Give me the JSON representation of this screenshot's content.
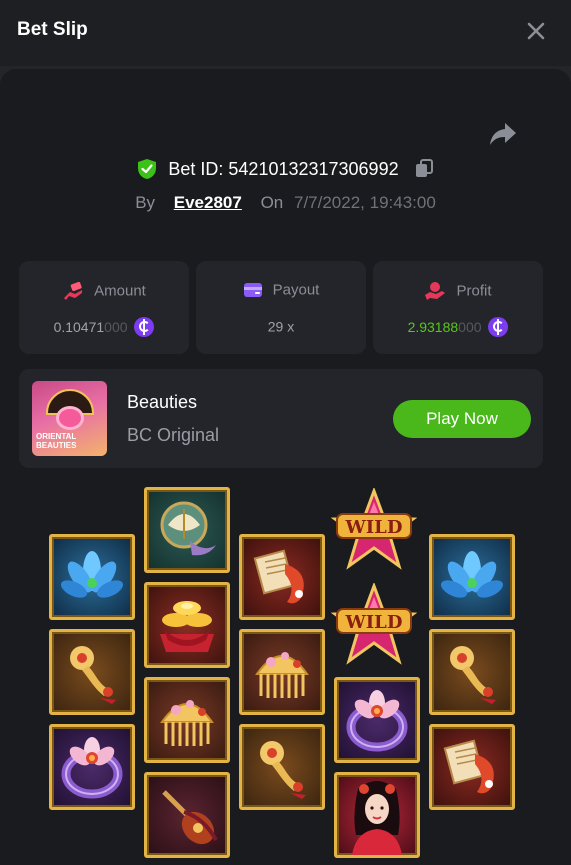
{
  "header": {
    "title": "Bet Slip",
    "close_icon": "close-icon"
  },
  "bet": {
    "share_icon": "share-icon",
    "verified_icon": "shield-check-icon",
    "id_text": "Bet ID: 54210132317306992",
    "copy_icon": "copy-icon",
    "by_label": "By",
    "user": "Eve2807",
    "on_label": "On",
    "date": "7/7/2022, 19:43:00"
  },
  "stats": {
    "amount": {
      "label": "Amount",
      "value_main": "0.10471",
      "value_dim": "000",
      "icon": "money-hand-icon",
      "currency_icon": "coin-icon"
    },
    "payout": {
      "label": "Payout",
      "value": "29 x",
      "icon": "wallet-icon"
    },
    "profit": {
      "label": "Profit",
      "value_main": "2.93188",
      "value_dim": "000",
      "icon": "hand-coin-icon",
      "currency_icon": "coin-icon"
    }
  },
  "game": {
    "thumb_text": "ORIENTAL BEAUTIES",
    "name": "Beauties",
    "provider": "BC Original",
    "play_label": "Play Now"
  },
  "reels": {
    "symbols": [
      [
        "blue-lotus",
        "comb-charm",
        "lotus-ring"
      ],
      [
        "fan-mirror",
        "gold-ingots",
        "golden-comb",
        "pipa-lute"
      ],
      [
        "koi-scroll",
        "golden-comb",
        "comb-charm"
      ],
      [
        "wild",
        "wild",
        "lotus-ring",
        "beauty-portrait"
      ],
      [
        "blue-lotus",
        "comb-charm",
        "koi-scroll"
      ]
    ],
    "wild_label": "WILD"
  },
  "colors": {
    "accent_green": "#4ab81a",
    "profit_green": "#58c71a",
    "coin_purple": "#7c3cf0",
    "tile_gold": "#e3b445"
  }
}
